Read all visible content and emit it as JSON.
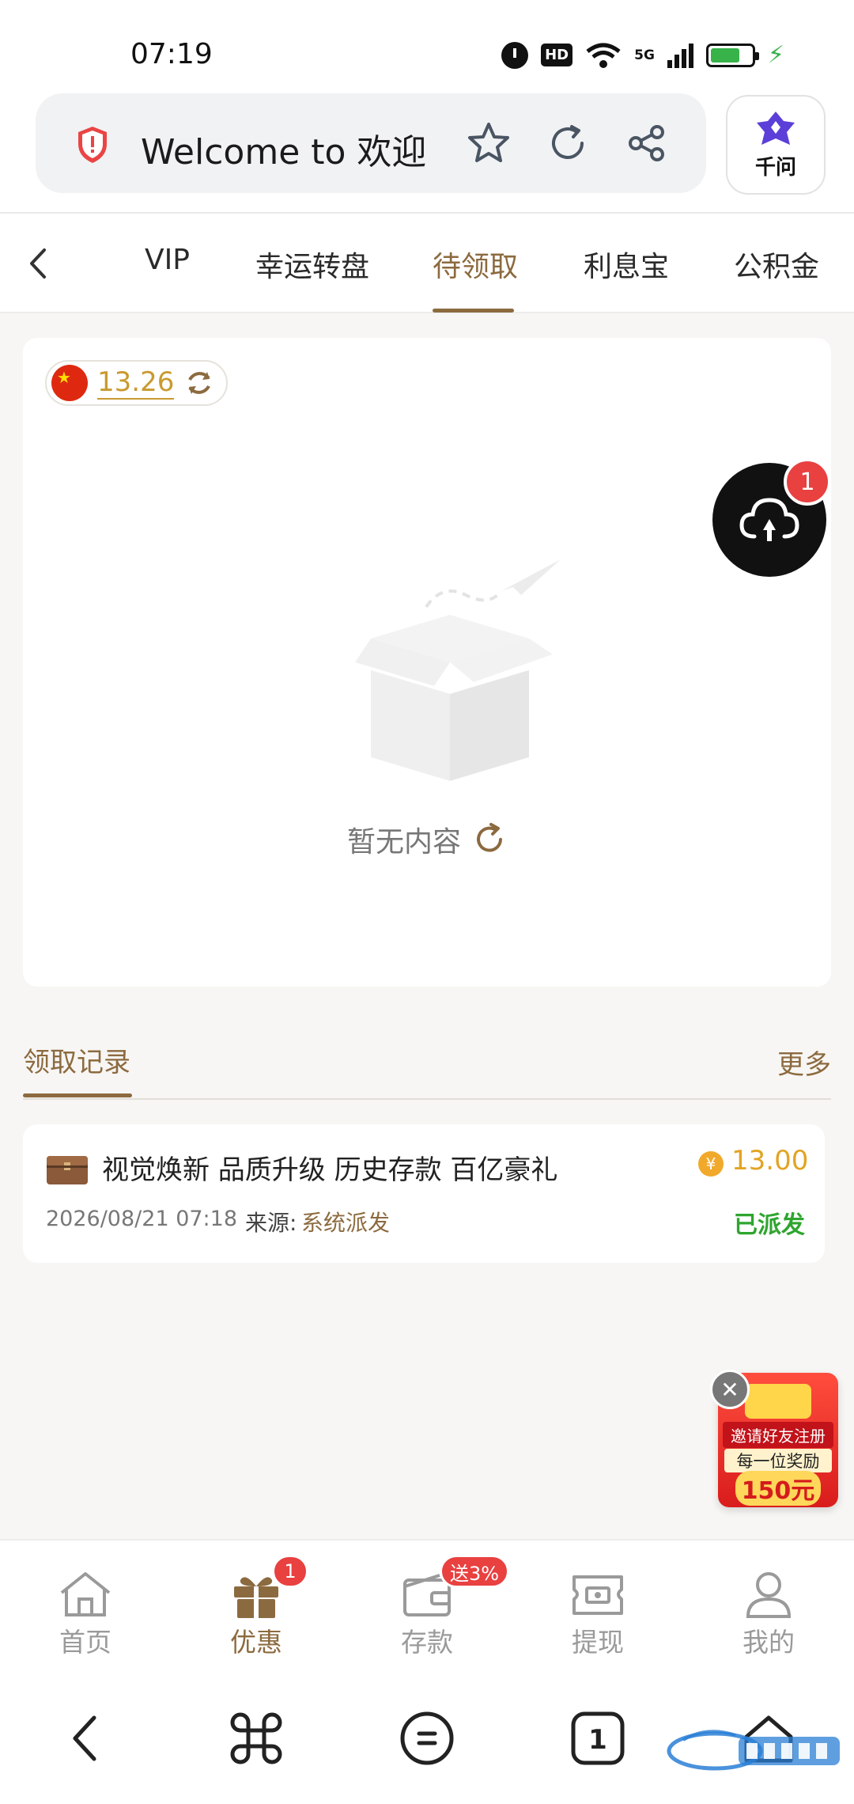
{
  "status_bar": {
    "time": "07:19",
    "hd": "HD",
    "network": "5G"
  },
  "browser": {
    "url_title": "Welcome to 欢迎",
    "assistant_label": "千问"
  },
  "tabs": {
    "items": [
      "VIP",
      "幸运转盘",
      "待领取",
      "利息宝",
      "公积金"
    ],
    "active": "待领取"
  },
  "balance": {
    "value": "13.26"
  },
  "empty_state": {
    "text": "暂无内容"
  },
  "service": {
    "badge": "1"
  },
  "records": {
    "title": "领取记录",
    "more": "更多",
    "items": [
      {
        "title": "视觉焕新 品质升级 历史存款 百亿豪礼",
        "amount": "13.00",
        "time": "2026/08/21 07:18",
        "source_label": "来源:",
        "source": "系统派发",
        "status": "已派发"
      }
    ]
  },
  "promo": {
    "line1": "邀请好友注册",
    "line2": "每一位奖励",
    "line3": "150元"
  },
  "bottom_nav": {
    "items": [
      {
        "label": "首页",
        "icon": "home-icon"
      },
      {
        "label": "优惠",
        "icon": "gift-icon",
        "badge": "1"
      },
      {
        "label": "存款",
        "icon": "wallet-icon",
        "badge": "送3%"
      },
      {
        "label": "提现",
        "icon": "withdraw-ticket-icon"
      },
      {
        "label": "我的",
        "icon": "user-icon"
      }
    ],
    "active": "优惠"
  },
  "system_nav": {
    "tab_count": "1"
  },
  "colors": {
    "accent": "#8c6a3f",
    "gold": "#e3a323",
    "success": "#2fa52f",
    "badge": "#e94040"
  }
}
